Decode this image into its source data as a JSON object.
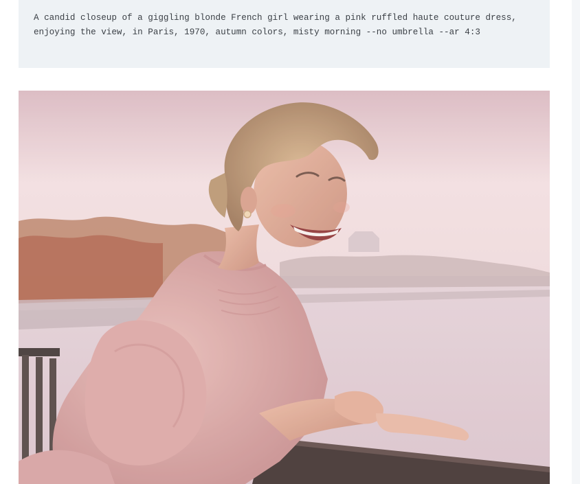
{
  "prompt": {
    "text": "A candid closeup of a giggling blonde French girl wearing a pink ruffled haute couture dress, enjoying the view, in Paris, 1970, autumn colors, misty morning --no umbrella --ar 4:3"
  },
  "image": {
    "subject": "smiling blonde woman in pink ruffled dress leaning on railing by misty river with autumn trees",
    "palette": {
      "sky": "#f1dde0",
      "water": "#e6d3d8",
      "trees": "#b87a5e",
      "dress": "#d8a5a4",
      "hair": "#b48c66",
      "skin": "#e2aa93",
      "railing": "#3a2c2a"
    }
  }
}
